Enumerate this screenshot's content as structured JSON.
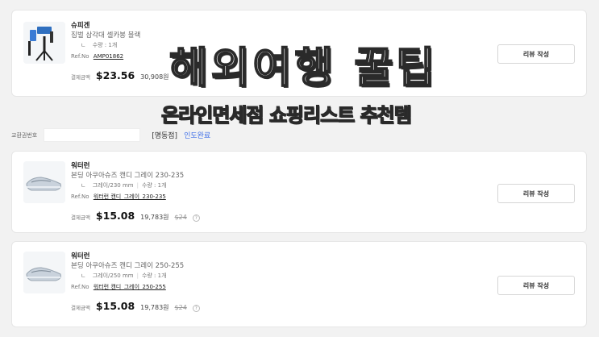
{
  "orders": [
    {
      "brand": "슈피겐",
      "product_name": "짐벌 삼각대 셀카봉 블랙",
      "option_prefix": "ㄴ",
      "option": "",
      "quantity": "수량 : 1개",
      "ref_label": "Ref.No",
      "ref_no": "AMP01862",
      "pay_label": "결제금액",
      "price_usd": "$23.56",
      "price_krw": "30,908원",
      "price_original": "",
      "review_button": "리뷰 작성"
    },
    {
      "brand": "워터런",
      "product_name": "본딩 아쿠아슈즈 캔디 그레이 230-235",
      "option_prefix": "ㄴ",
      "option": "그레이/230 mm",
      "quantity": "수량 : 1개",
      "ref_label": "Ref.No",
      "ref_no": "워터런 캔디_그레이_230-235",
      "pay_label": "결제금액",
      "price_usd": "$15.08",
      "price_krw": "19,783원",
      "price_original": "$24",
      "info_icon": "?",
      "review_button": "리뷰 작성"
    },
    {
      "brand": "워터런",
      "product_name": "본딩 아쿠아슈즈 캔디 그레이 250-255",
      "option_prefix": "ㄴ",
      "option": "그레이/250 mm",
      "quantity": "수량 : 1개",
      "ref_label": "Ref.No",
      "ref_no": "워터런 캔디_그레이_250-255",
      "pay_label": "결제금액",
      "price_usd": "$15.08",
      "price_krw": "19,783원",
      "price_original": "$24",
      "info_icon": "?",
      "review_button": "리뷰 작성"
    }
  ],
  "exchange": {
    "label": "교환권번호",
    "store": "[명동점]",
    "status": "인도완료"
  },
  "overlay": {
    "title": "해외여행 꿀팁",
    "subtitle": "온라인면세점 쇼핑리스트 추천템"
  },
  "colors": {
    "status_blue": "#3d6ee8",
    "card_bg": "#ffffff",
    "page_bg": "#f2f2f2"
  }
}
